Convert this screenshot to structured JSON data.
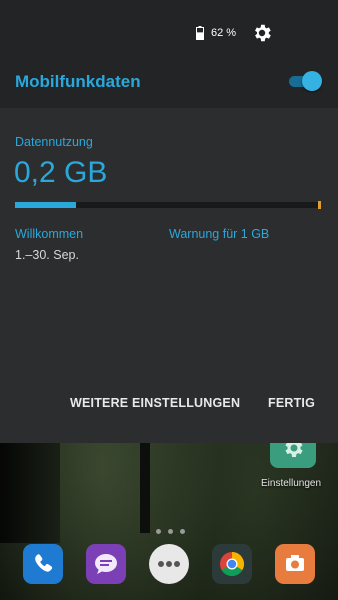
{
  "status_bar": {
    "battery_text": "62 %",
    "battery_level": 0.62
  },
  "panel": {
    "title": "Mobilfunkdaten",
    "toggle_on": true,
    "usage_label": "Datennutzung",
    "usage_value": "0,2 GB",
    "usage_fraction": 0.2,
    "welcome_text": "Willkommen",
    "warning_text": "Warnung für 1 GB",
    "period_text": "1.–30. Sep.",
    "more_settings_label": "WEITERE EINSTELLUNGEN",
    "done_label": "FERTIG"
  },
  "homescreen": {
    "settings_app_label": "Einstellungen",
    "dock_icons": [
      "phone-icon",
      "messages-icon",
      "apps-icon",
      "chrome-icon",
      "camera-icon"
    ]
  },
  "colors": {
    "accent": "#2aa8dc",
    "panel_bg": "#2b2d2f",
    "warning_marker": "#e89a2c"
  }
}
